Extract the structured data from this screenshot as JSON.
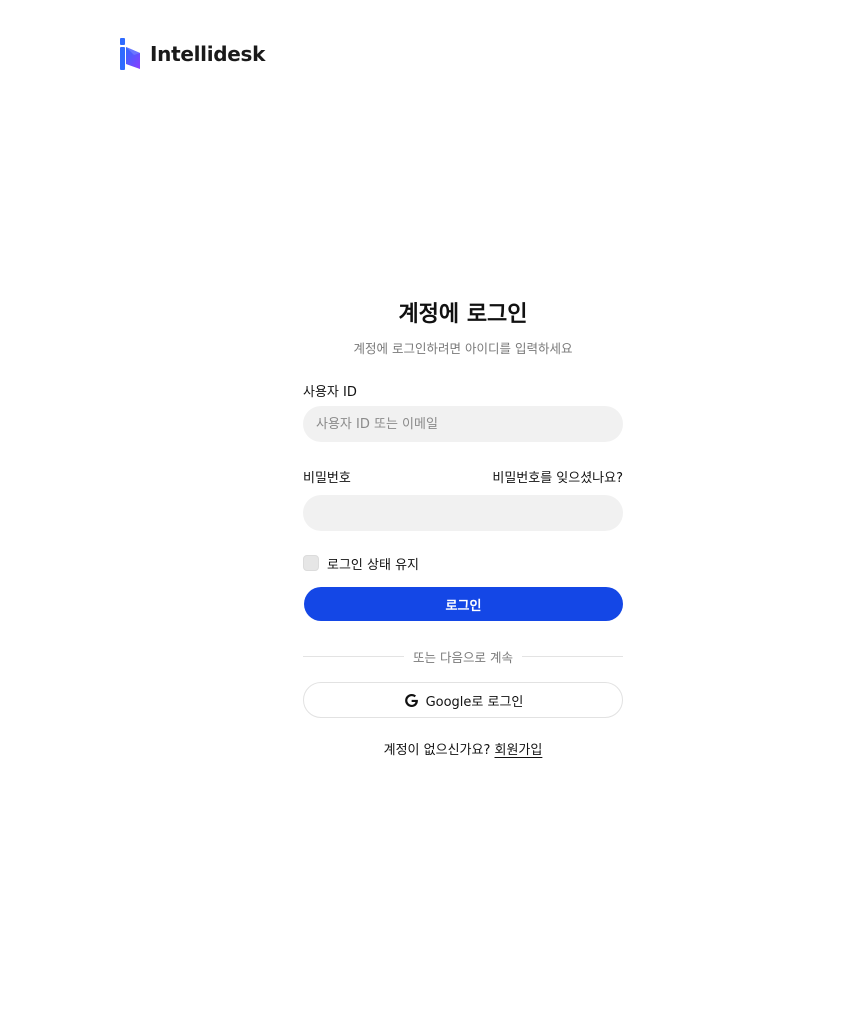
{
  "brand": {
    "name": "Intellidesk",
    "icon": "intellidesk-logo-icon"
  },
  "login": {
    "title": "계정에 로그인",
    "subtitle": "계정에 로그인하려면 아이디를 입력하세요",
    "username": {
      "label": "사용자 ID",
      "placeholder": "사용자 ID 또는 이메일",
      "value": ""
    },
    "password": {
      "label": "비밀번호",
      "forgot_label": "비밀번호를 잊으셨나요?",
      "value": ""
    },
    "remember": {
      "label": "로그인 상태 유지",
      "checked": false
    },
    "submit_label": "로그인",
    "divider_text": "또는 다음으로 계속",
    "google": {
      "label": "Google로 로그인",
      "icon": "google-icon"
    },
    "signup": {
      "prompt": "계정이 없으신가요?",
      "link_label": "회원가입"
    }
  },
  "colors": {
    "accent": "#1447E6",
    "input_bg": "#F1F1F1",
    "logo_gradient": [
      "#2F6BFF",
      "#8B3DFF"
    ]
  }
}
